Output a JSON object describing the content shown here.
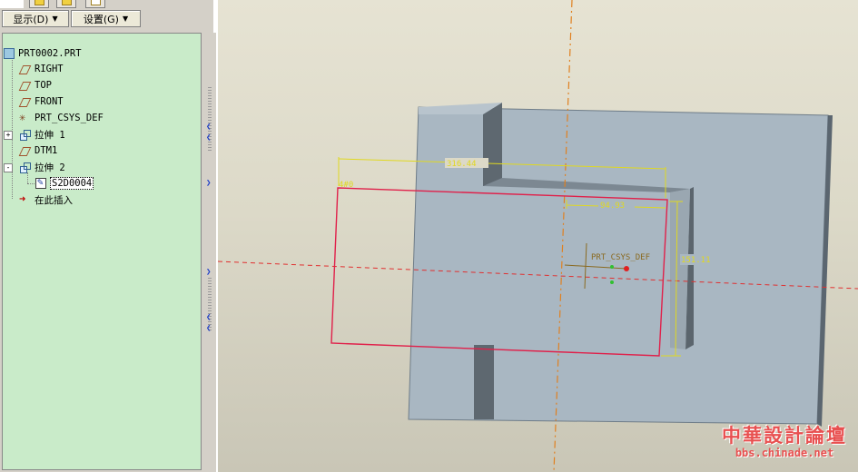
{
  "toolbar": {
    "display_label": "显示(D)",
    "settings_label": "设置(G)",
    "tab_icons": [
      "folder-icon",
      "layer-icon",
      "notes-icon"
    ]
  },
  "model_tree": {
    "root": "PRT0002.PRT",
    "items": [
      {
        "label": "RIGHT",
        "icon": "datum-plane-icon"
      },
      {
        "label": "TOP",
        "icon": "datum-plane-icon"
      },
      {
        "label": "FRONT",
        "icon": "datum-plane-icon"
      },
      {
        "label": "PRT_CSYS_DEF",
        "icon": "coordinate-system-icon"
      },
      {
        "label": "拉伸 1",
        "icon": "extrude-icon",
        "expander": "+"
      },
      {
        "label": "DTM1",
        "icon": "datum-plane-icon"
      },
      {
        "label": "拉伸 2",
        "icon": "extrude-icon",
        "expander": "-"
      },
      {
        "label": "S2D0004",
        "icon": "sketch-icon",
        "selected": true
      },
      {
        "label": "在此插入",
        "icon": "insert-here-icon"
      }
    ]
  },
  "viewport": {
    "dimensions": {
      "overall_width": "316.44",
      "inner_width": "94.93",
      "height": "151.11"
    },
    "csys_label": "PRT_CSYS_DEF",
    "sketch_label": "4#0",
    "colors": {
      "sketch": "#e0204a",
      "dimension": "#e0d820",
      "datum_axis": "#e08020",
      "model": "#a9b7c2"
    }
  },
  "watermark": {
    "title": "中華設計論壇",
    "url": "bbs.chinade.net"
  }
}
